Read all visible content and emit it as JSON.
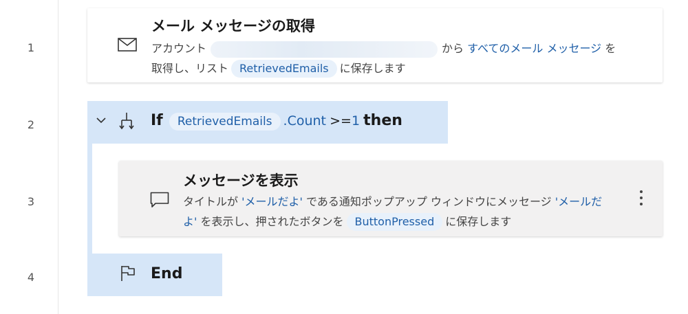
{
  "line_numbers": [
    "1",
    "2",
    "3",
    "4"
  ],
  "step1": {
    "title": "メール メッセージの取得",
    "desc_prefix": "アカウント",
    "desc_from": "から",
    "desc_link": "すべてのメール メッセージ",
    "desc_wo": "を",
    "desc_line2_prefix": "取得し、リスト",
    "desc_var": "RetrievedEmails",
    "desc_line2_suffix": "に保存します",
    "icon": "mail-icon"
  },
  "step2": {
    "keyword_if": "If",
    "var": "RetrievedEmails",
    "prop": ".Count",
    "op": ">=",
    "value": "1",
    "keyword_then": "then",
    "icon": "branch-icon",
    "toggle_icon": "chevron-down-icon"
  },
  "step3": {
    "title": "メッセージを表示",
    "desc_prefix": "タイトルが",
    "title_value": "'メールだよ'",
    "desc_mid": "である通知ポップアップ ウィンドウにメッセージ",
    "message_value_part1": "'メールだ",
    "message_value_part2": "よ'",
    "desc_line2_mid": "を表示し、押されたボタンを",
    "desc_var": "ButtonPressed",
    "desc_line2_suffix": "に保存します",
    "icon": "message-icon",
    "more_icon": "more-vertical-icon"
  },
  "step4": {
    "keyword": "End",
    "icon": "flag-icon"
  },
  "colors": {
    "accent": "#1f5fa8",
    "pill_bg": "#e8f1fb",
    "block_bg": "#d6e6f8",
    "selected_card_bg": "#f2f1f1"
  }
}
